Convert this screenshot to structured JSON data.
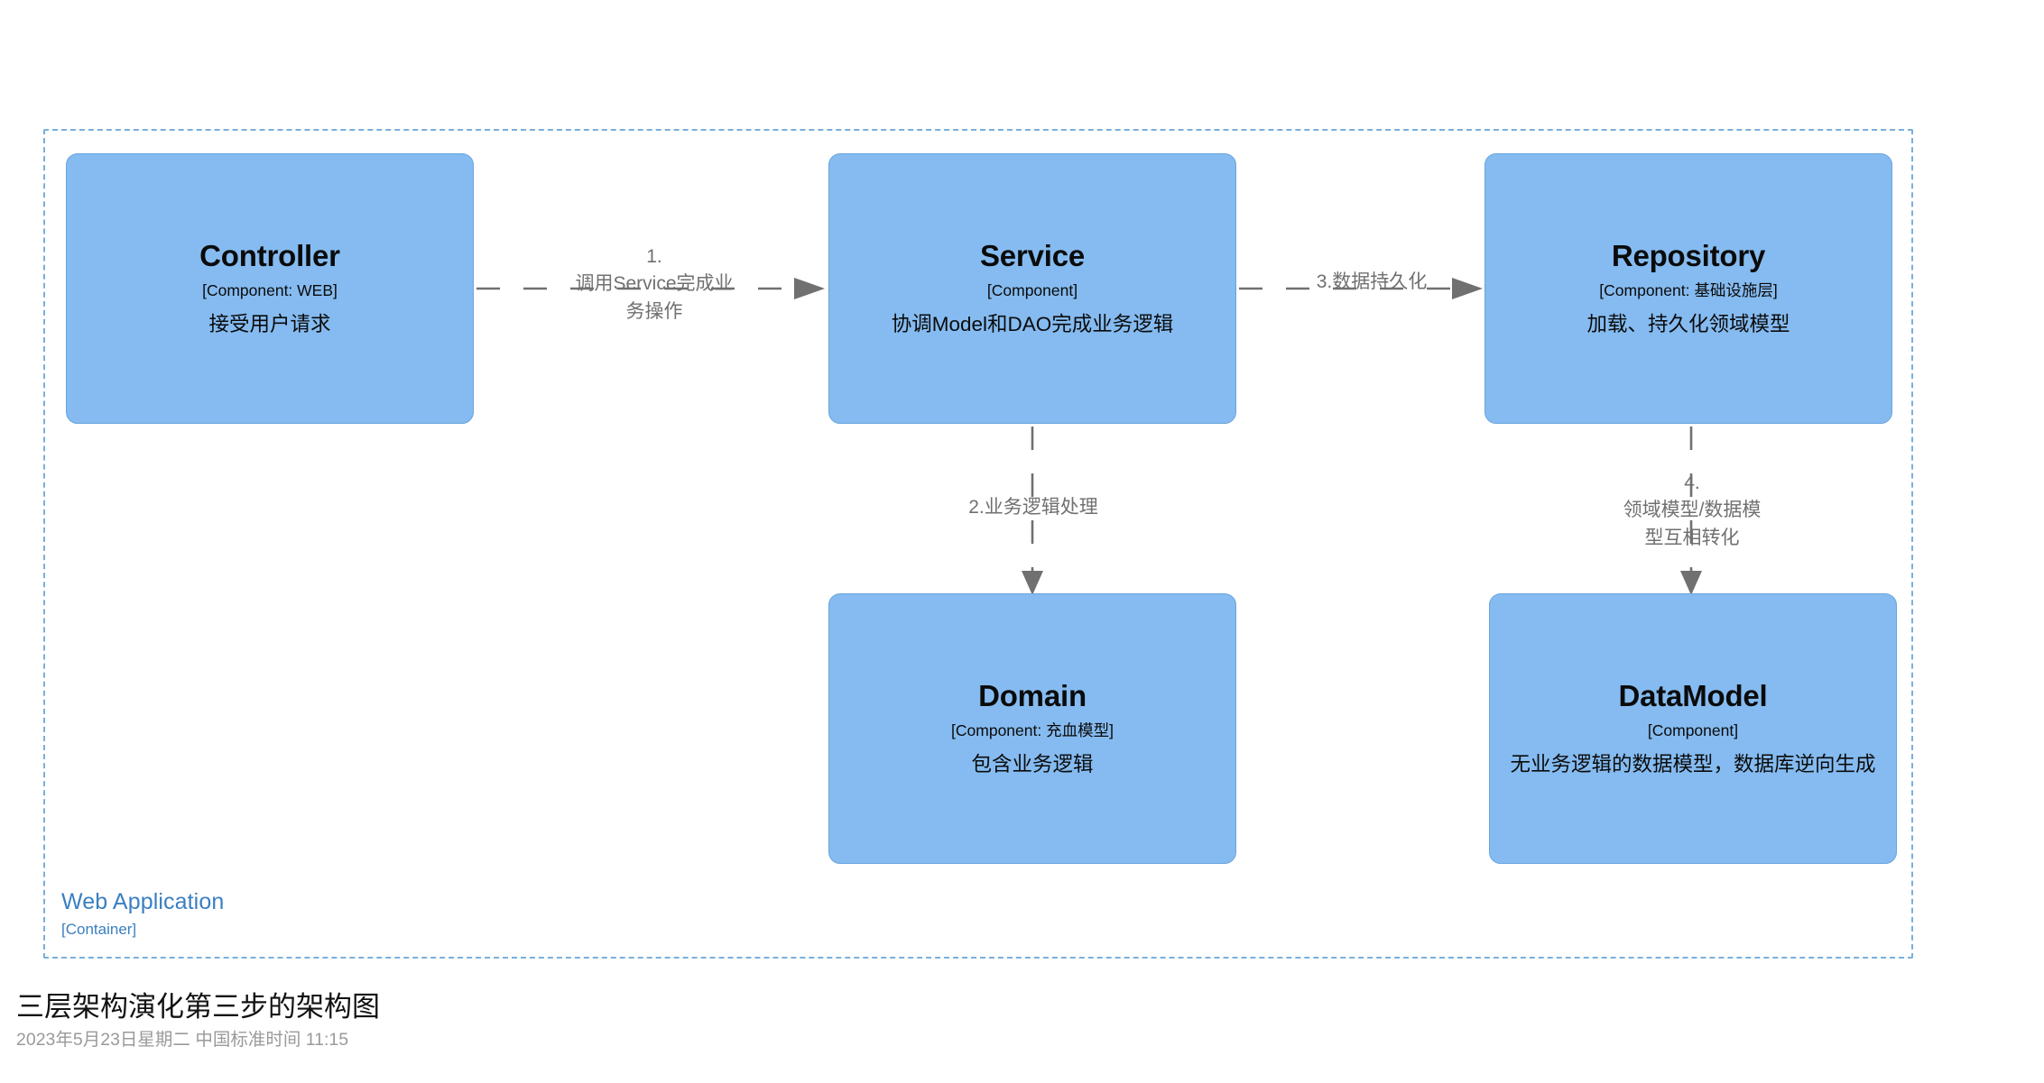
{
  "container": {
    "name": "Web Application",
    "type": "[Container]",
    "border_color": "#7aafdc"
  },
  "theme": {
    "component_fill": "#85bbf0",
    "component_border": "#6aa5dd",
    "component_text": "#0b0b0b",
    "connector_color": "#707070",
    "container_text": "#3a7fc1"
  },
  "components": [
    {
      "id": "controller",
      "title": "Controller",
      "subtitle": "[Component: WEB]",
      "description": "接受用户请求"
    },
    {
      "id": "service",
      "title": "Service",
      "subtitle": "[Component]",
      "description": "协调Model和DAO完成业务逻辑"
    },
    {
      "id": "repository",
      "title": "Repository",
      "subtitle": "[Component: 基础设施层]",
      "description": "加载、持久化领域模型"
    },
    {
      "id": "domain",
      "title": "Domain",
      "subtitle": "[Component: 充血模型]",
      "description": "包含业务逻辑"
    },
    {
      "id": "datamodel",
      "title": "DataModel",
      "subtitle": "[Component]",
      "description": "无业务逻辑的数据模型，数据库逆向生成"
    }
  ],
  "connections": [
    {
      "id": "c1",
      "from": "controller",
      "to": "service",
      "direction": "right",
      "label": "1.\n调用Service完成业\n务操作"
    },
    {
      "id": "c2",
      "from": "service",
      "to": "domain",
      "direction": "down",
      "label": "2.业务逻辑处理"
    },
    {
      "id": "c3",
      "from": "service",
      "to": "repository",
      "direction": "right",
      "label": "3.数据持久化"
    },
    {
      "id": "c4",
      "from": "repository",
      "to": "datamodel",
      "direction": "down",
      "label": "4.\n领域模型/数据模\n型互相转化"
    }
  ],
  "footer": {
    "title": "三层架构演化第三步的架构图",
    "timestamp": "2023年5月23日星期二 中国标准时间 11:15"
  }
}
